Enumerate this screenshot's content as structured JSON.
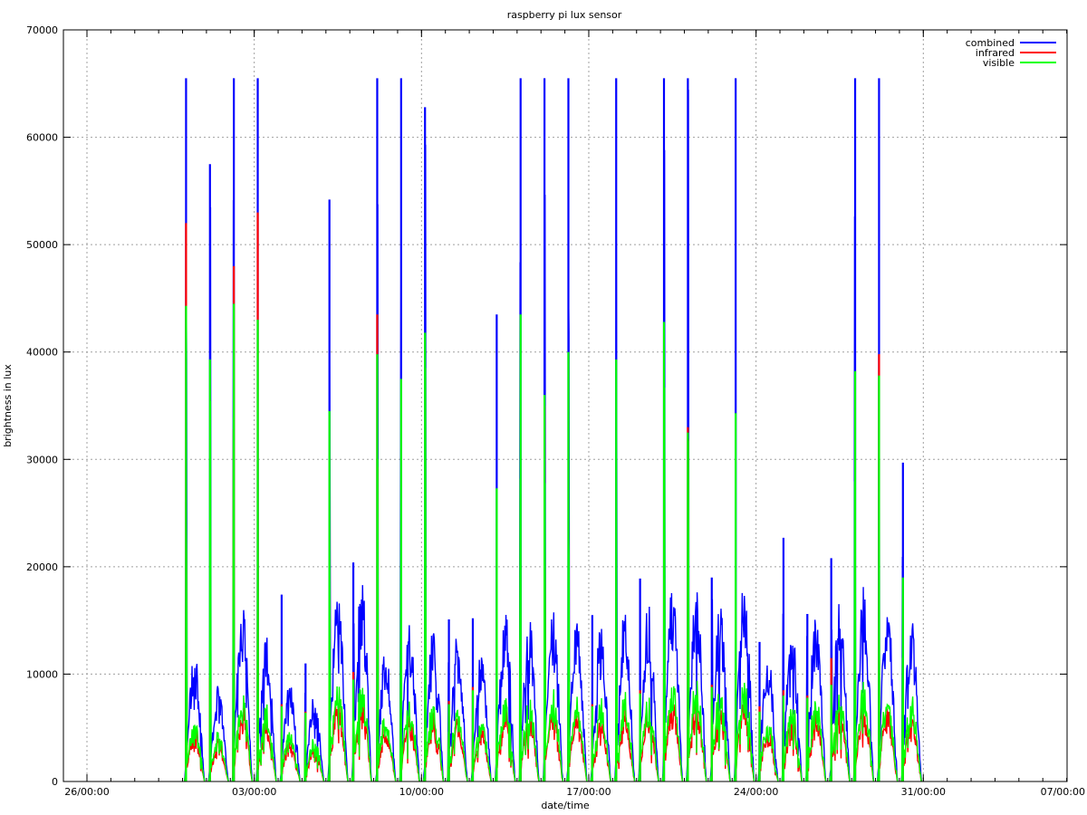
{
  "chart_data": {
    "type": "line",
    "title": "raspberry pi lux sensor",
    "xlabel": "date/time",
    "ylabel": "brightness in lux",
    "ylim": [
      0,
      70000
    ],
    "yticks": [
      0,
      10000,
      20000,
      30000,
      40000,
      50000,
      60000,
      70000
    ],
    "xlim_days": [
      -1,
      41
    ],
    "xticks": [
      {
        "label": "26/00:00",
        "day": 0
      },
      {
        "label": "03/00:00",
        "day": 7
      },
      {
        "label": "10/00:00",
        "day": 14
      },
      {
        "label": "17/00:00",
        "day": 21
      },
      {
        "label": "24/00:00",
        "day": 28
      },
      {
        "label": "31/00:00",
        "day": 35
      },
      {
        "label": "07/00:00",
        "day": 42
      }
    ],
    "grid": true,
    "legend_position": "top-right",
    "series": [
      {
        "name": "combined",
        "color": "#0000ff"
      },
      {
        "name": "infrared",
        "color": "#ff0000"
      },
      {
        "name": "visible",
        "color": "#00ff00"
      }
    ],
    "days": [
      {
        "day": 4.5,
        "combined": 65500,
        "infrared": 52000,
        "visible": 44300,
        "base": 12000
      },
      {
        "day": 5.5,
        "combined": 57500,
        "infrared": 9700,
        "visible": 39300,
        "base": 9000
      },
      {
        "day": 6.5,
        "combined": 65500,
        "infrared": 48000,
        "visible": 44500,
        "base": 17000
      },
      {
        "day": 7.5,
        "combined": 65500,
        "infrared": 53000,
        "visible": 43000,
        "base": 14000
      },
      {
        "day": 8.5,
        "combined": 17400,
        "infrared": 7200,
        "visible": 7000,
        "base": 9500
      },
      {
        "day": 9.5,
        "combined": 11000,
        "infrared": 6500,
        "visible": 6400,
        "base": 8000
      },
      {
        "day": 10.5,
        "combined": 54200,
        "infrared": 9800,
        "visible": 34500,
        "base": 18000
      },
      {
        "day": 11.5,
        "combined": 20400,
        "infrared": 10200,
        "visible": 9500,
        "base": 19000
      },
      {
        "day": 12.5,
        "combined": 65500,
        "infrared": 43500,
        "visible": 39800,
        "base": 12500
      },
      {
        "day": 13.5,
        "combined": 65500,
        "infrared": 8000,
        "visible": 37500,
        "base": 15000
      },
      {
        "day": 14.5,
        "combined": 62800,
        "infrared": 7200,
        "visible": 41800,
        "base": 14500
      },
      {
        "day": 15.5,
        "combined": 15100,
        "infrared": 7500,
        "visible": 7200,
        "base": 14000
      },
      {
        "day": 16.5,
        "combined": 15200,
        "infrared": 8800,
        "visible": 8500,
        "base": 12000
      },
      {
        "day": 17.5,
        "combined": 43500,
        "infrared": 9500,
        "visible": 27300,
        "base": 16000
      },
      {
        "day": 18.5,
        "combined": 65500,
        "infrared": 9800,
        "visible": 43500,
        "base": 15500
      },
      {
        "day": 19.5,
        "combined": 65500,
        "infrared": 35000,
        "visible": 36000,
        "base": 16000
      },
      {
        "day": 20.5,
        "combined": 65500,
        "infrared": 8500,
        "visible": 40000,
        "base": 15000
      },
      {
        "day": 21.5,
        "combined": 15500,
        "infrared": 7200,
        "visible": 7000,
        "base": 14500
      },
      {
        "day": 22.5,
        "combined": 65500,
        "infrared": 9000,
        "visible": 39300,
        "base": 16000
      },
      {
        "day": 23.5,
        "combined": 18900,
        "infrared": 8500,
        "visible": 8200,
        "base": 17000
      },
      {
        "day": 24.5,
        "combined": 65500,
        "infrared": 9500,
        "visible": 42800,
        "base": 18500
      },
      {
        "day": 25.5,
        "combined": 65500,
        "infrared": 33000,
        "visible": 32500,
        "base": 18000
      },
      {
        "day": 26.5,
        "combined": 19000,
        "infrared": 9000,
        "visible": 8800,
        "base": 16500
      },
      {
        "day": 27.5,
        "combined": 65500,
        "infrared": 10000,
        "visible": 34300,
        "base": 19000
      },
      {
        "day": 28.5,
        "combined": 13000,
        "infrared": 7000,
        "visible": 6500,
        "base": 12000
      },
      {
        "day": 29.5,
        "combined": 22700,
        "infrared": 8500,
        "visible": 8000,
        "base": 14500
      },
      {
        "day": 30.5,
        "combined": 15600,
        "infrared": 8000,
        "visible": 7800,
        "base": 15500
      },
      {
        "day": 31.5,
        "combined": 20800,
        "infrared": 11500,
        "visible": 9000,
        "base": 17000
      },
      {
        "day": 32.5,
        "combined": 65500,
        "infrared": 10000,
        "visible": 38200,
        "base": 18300
      },
      {
        "day": 33.5,
        "combined": 65500,
        "infrared": 39800,
        "visible": 37800,
        "base": 17000
      },
      {
        "day": 34.5,
        "combined": 29700,
        "infrared": 9000,
        "visible": 19000,
        "base": 15200
      }
    ]
  }
}
